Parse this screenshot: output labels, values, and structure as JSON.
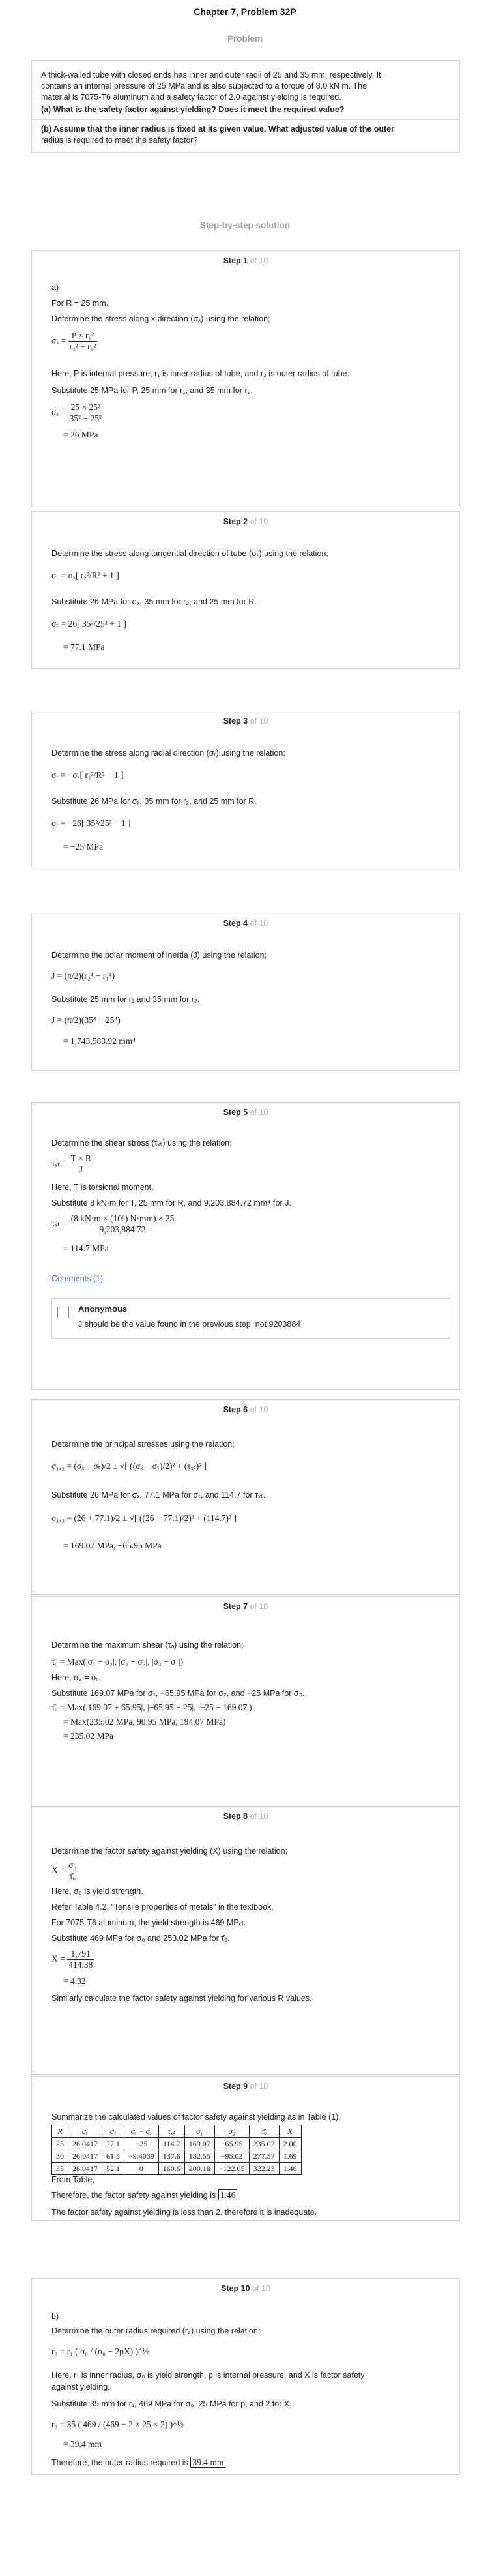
{
  "page_title": "Chapter 7, Problem 32P",
  "problem_head": "Problem",
  "problem": {
    "line1": "A thick-walled tube with closed ends has inner and outer radii of 25 and 35 mm, respectively. It",
    "line2": "contains an internal pressure of 25 MPa and is also subjected to a torque of 8.0 kN m. The",
    "line3": "material is 7075-T6 aluminum and a safety factor of 2.0 against yielding is required.",
    "part_a": "(a) What is the safety factor against yielding? Does it meet the required value?",
    "part_b1": "(b) Assume that the inner radius is fixed at its given value. What adjusted value of the outer",
    "part_b2": "radius is required to meet the safety factor?"
  },
  "solution_head": "Step-by-step solution",
  "of_label": "of 10",
  "steps": {
    "s1": {
      "title": "Step 1",
      "a": "a)",
      "t1": "For  R = 25 mm.",
      "t2": "Determine the stress along x direction  (σₓ) using the relation;",
      "t3": "Here, P is internal pressure,  r₁ is inner radius of tube, and  r₂ is outer radius of tube.",
      "t4": "Substitute 25 MPa for P, 25 mm for  r₁, and 35 mm for  r₂.",
      "eq_lhs": "σₓ =",
      "eq_n": "P × r₁²",
      "eq_d": "r₂² − r₁²",
      "sub_lhs": "σₓ =",
      "sub_n": "25 × 25²",
      "sub_d": "35² − 25²",
      "res": "= 26 MPa"
    },
    "s2": {
      "title": "Step 2",
      "t1": "Determine the stress along tangential direction of tube  (σₜ) using the relation;",
      "eq": "σₜ = σₓ[ r₂²/R² + 1 ]",
      "t2": "Substitute 26 MPa for  σₓ, 35 mm for  r₂, and 25 mm for R.",
      "sub": "σₜ = 26[ 35²/25² + 1 ]",
      "res": "= 77.1 MPa"
    },
    "s3": {
      "title": "Step 3",
      "t1": "Determine the stress along radial direction  (σᵣ) using the relation;",
      "eq": "σᵣ = −σₓ[ r₂²/R² − 1 ]",
      "t2": "Substitute 26 MPa for  σₓ, 35 mm for  r₂, and 25 mm for R.",
      "sub": "σᵣ = −26[ 35²/25² − 1 ]",
      "res": "= −25 MPa"
    },
    "s4": {
      "title": "Step 4",
      "t1": "Determine the polar moment of inertia (J) using the relation;",
      "eq": "J = (π/2)(r₂⁴ − r₁⁴)",
      "t2": "Substitute 25 mm for  r₁ and 35 mm for  r₂.",
      "sub": "J = (π/2)(35⁴ − 25⁴)",
      "res": "= 1,743,583.92 mm⁴"
    },
    "s5": {
      "title": "Step 5",
      "t1": "Determine the shear stress  (τₓₜ) using the relation;",
      "eq_lhs": "τₓₜ =",
      "eq_n": "T × R",
      "eq_d": "J",
      "t2": "Here, T is torsional moment.",
      "t3": "Substitute 8 kN·m for T, 25 mm for R, and  9,203,884.72 mm⁴ for J.",
      "sub_lhs": "τₓₜ =",
      "sub_n": "(8 kN·m × (10⁶) N·mm) × 25",
      "sub_d": "9,203,884.72",
      "res": "= 114.7 MPa",
      "comments_link": "Comments (1)",
      "comment_author": "Anonymous",
      "comment_text": "J should be the value found in the previous step, not 9203884"
    },
    "s6": {
      "title": "Step 6",
      "t1": "Determine the principal stresses using the relation;",
      "eq": "σ₁,₂ = (σₓ + σₜ)/2 ± √[ ((σₓ − σₜ)/2)² + (τₓₜ)² ]",
      "t2": "Substitute 26 MPa for  σₓ, 77.1 MPa for  σₜ, and 114.7 for  τₓₜ.",
      "sub": "σ₁,₂ = (26 + 77.1)/2 ± √[ ((26 − 77.1)/2)² + (114.7)² ]",
      "res": "= 169.07 MPa, −65.95 MPa"
    },
    "s7": {
      "title": "Step 7",
      "t1": "Determine the maximum shear  (τ̄ₒ) using the relation;",
      "eq": "τ̄ₒ = Max(|σ₁ − σ₂|, |σ₂ − σ₃|, |σ₃ − σ₁|)",
      "t2": "Here,  σ₃ = σᵣ.",
      "t3": "Substitute 169.07 MPa for  σ₁, −65.95 MPa for  σ₂, and −25 MPa for  σ₃.",
      "sub": "τ̄ₒ = Max(|169.07 + 65.95|, |−65.95 − 25|, |−25 − 169.07|)",
      "sub2": "= Max(235.02 MPa, 90.95 MPa, 194.07 MPa)",
      "res": "= 235.02 MPa"
    },
    "s8": {
      "title": "Step 8",
      "t1": "Determine the factor safety against yielding (X) using the relation;",
      "eq_lhs": "X =",
      "eq_n": "σ₀",
      "eq_d": "τ̄ₒ",
      "t2": "Here,  σ₀ is yield strength.",
      "t3": "Refer Table 4.2, \"Tensile properties of metals\" in the textbook,",
      "t4": "For 7075-T6 aluminum, the yield strength is 469 MPa.",
      "t5": "Substitute 469 MPa for  σ₀ and 253.02 MPa for  τ̄ₒ.",
      "sub_lhs": "X =",
      "sub_n": "1,791",
      "sub_d": "414.38",
      "res": "= 4.32",
      "t6": "Similarly calculate the factor safety against yielding for various R values."
    },
    "s9": {
      "title": "Step 9",
      "t1": "Summarize the calculated values of factor safety against yielding as in Table (1).",
      "t2": "From Table,",
      "t3_pre": "Therefore, the factor safety against yielding is",
      "t3_val": "1.46",
      "t4": "The factor safety against yielding is less than 2, therefore it is inadequate.",
      "headers": [
        "R",
        "σₓ",
        "σₜ",
        "σᵣ − σₓ",
        "τₓₜ",
        "σ₁",
        "σ₂",
        "τ̄ₒ",
        "X"
      ],
      "rows": [
        [
          "25",
          "26.0417",
          "77.1",
          "−25",
          "114.7",
          "169.07",
          "−65.95",
          "235.02",
          "2.00"
        ],
        [
          "30",
          "26.0417",
          "61.5",
          "−9.4039",
          "137.6",
          "182.55",
          "−95.02",
          "277.57",
          "1.69"
        ],
        [
          "35",
          "26.0417",
          "52.1",
          "0",
          "160.6",
          "200.18",
          "−122.05",
          "322.23",
          "1.46"
        ]
      ]
    },
    "s10": {
      "title": "Step 10",
      "b": "b)",
      "t1": "Determine the outer radius required  (r₂) using the relation;",
      "eq": "r₂ = r₁ ( σ₀ / (σ₀ − 2pX) )^½",
      "t2": "Here,  r₁ is inner radius,  σ₀ is yield strength, p is internal pressure, and X is factor safety",
      "t2b": "against yielding.",
      "t3": "Substitute 35 mm for  r₁, 469 MPa for  σ₀, 25 MPa for p, and 2 for X.",
      "sub": "r₂ = 35 ( 469 / (469 − 2 × 25 × 2) )^½",
      "res": "= 39.4 mm",
      "t4_pre": "Therefore, the outer radius required is",
      "t4_val": "39.4 mm"
    }
  }
}
